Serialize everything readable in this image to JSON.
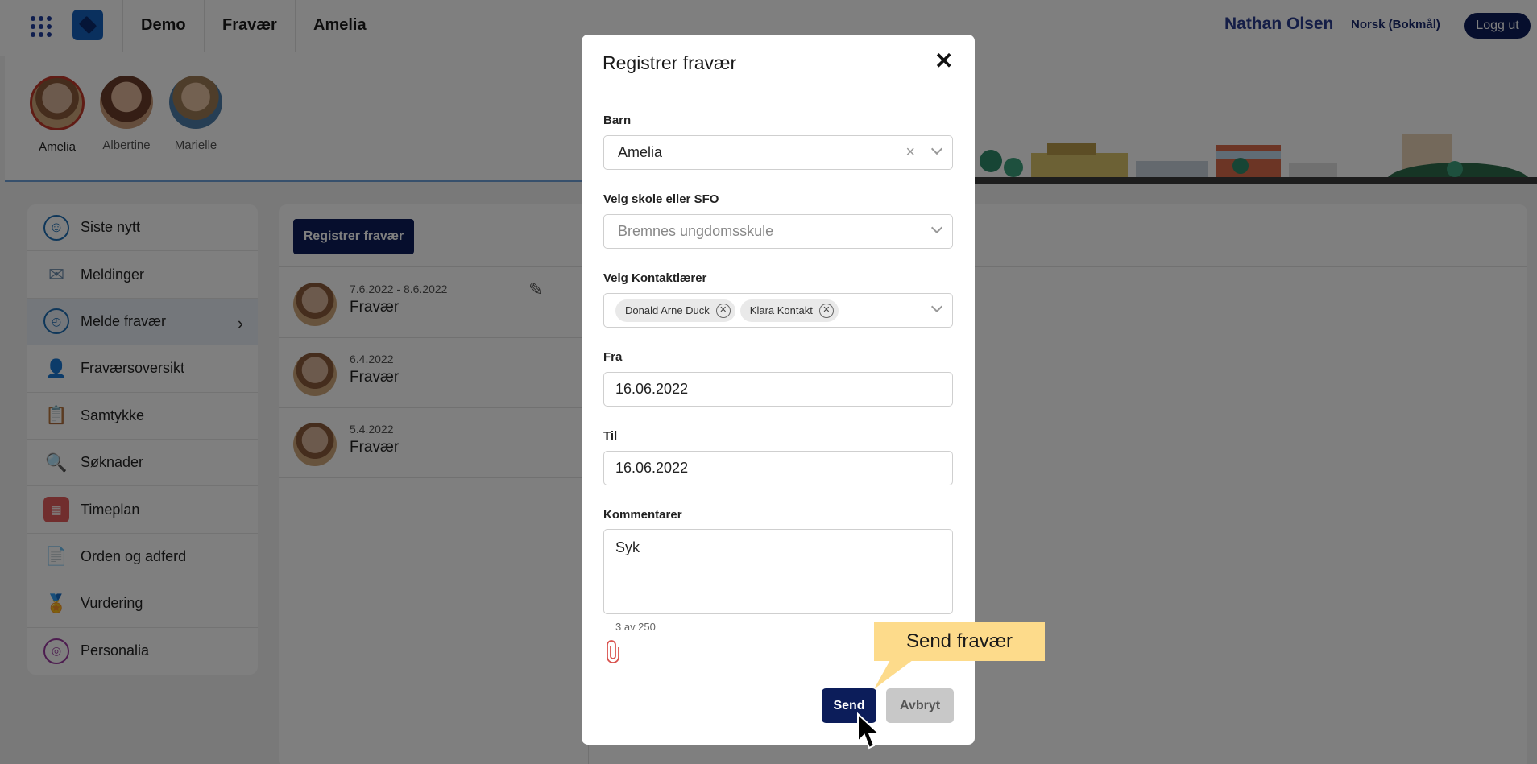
{
  "topbar": {
    "nav": [
      "Demo",
      "Fravær",
      "Amelia"
    ],
    "user_name": "Nathan Olsen",
    "language": "Norsk (Bokmål)",
    "logout_label": "Logg ut"
  },
  "children": [
    "Amelia",
    "Albertine",
    "Marielle"
  ],
  "sidebar": {
    "items": [
      {
        "label": "Siste nytt",
        "icon": "news-icon"
      },
      {
        "label": "Meldinger",
        "icon": "mail-icon"
      },
      {
        "label": "Melde fravær",
        "icon": "clock-icon"
      },
      {
        "label": "Fraværsoversikt",
        "icon": "person-absent-icon"
      },
      {
        "label": "Samtykke",
        "icon": "clipboard-icon"
      },
      {
        "label": "Søknader",
        "icon": "search-document-icon"
      },
      {
        "label": "Timeplan",
        "icon": "calendar-icon"
      },
      {
        "label": "Orden og adferd",
        "icon": "document-search-icon"
      },
      {
        "label": "Vurdering",
        "icon": "medal-icon"
      },
      {
        "label": "Personalia",
        "icon": "fingerprint-icon"
      }
    ]
  },
  "content": {
    "register_button": "Registrer fravær",
    "absences": [
      {
        "date": "7.6.2022 - 8.6.2022",
        "type": "Fravær"
      },
      {
        "date": "6.4.2022",
        "type": "Fravær"
      },
      {
        "date": "5.4.2022",
        "type": "Fravær"
      }
    ]
  },
  "modal": {
    "title": "Registrer fravær",
    "child_label": "Barn",
    "child_value": "Amelia",
    "school_label": "Velg skole eller SFO",
    "school_placeholder": "Bremnes ungdomsskule",
    "teacher_label": "Velg Kontaktlærer",
    "teachers": [
      "Donald Arne Duck",
      "Klara Kontakt"
    ],
    "from_label": "Fra",
    "from_value": "16.06.2022",
    "to_label": "Til",
    "to_value": "16.06.2022",
    "comment_label": "Kommentarer",
    "comment_value": "Syk",
    "counter": "3 av 250",
    "send_label": "Send",
    "cancel_label": "Avbryt"
  },
  "tooltip": "Send fravær",
  "colors": {
    "primary": "#0c1d5a",
    "tooltip_bg": "#fddb8b",
    "active_border": "#c0392b"
  }
}
